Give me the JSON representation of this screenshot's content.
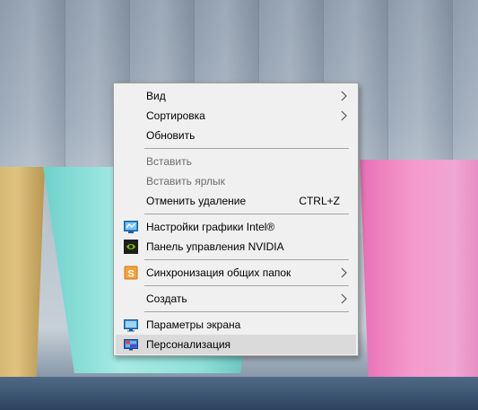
{
  "context_menu": {
    "items": [
      {
        "label": "Вид",
        "submenu": true
      },
      {
        "label": "Сортировка",
        "submenu": true
      },
      {
        "label": "Обновить"
      },
      {
        "label": "Вставить",
        "disabled": true
      },
      {
        "label": "Вставить ярлык",
        "disabled": true
      },
      {
        "label": "Отменить удаление",
        "shortcut": "CTRL+Z"
      },
      {
        "label": "Настройки графики Intel®",
        "icon": "intel-graphics-icon"
      },
      {
        "label": "Панель управления NVIDIA",
        "icon": "nvidia-icon"
      },
      {
        "label": "Синхронизация общих папок",
        "icon": "sync-folders-icon",
        "submenu": true
      },
      {
        "label": "Создать",
        "submenu": true
      },
      {
        "label": "Параметры экрана",
        "icon": "display-settings-icon"
      },
      {
        "label": "Персонализация",
        "icon": "personalization-icon",
        "highlighted": true
      }
    ]
  },
  "colors": {
    "menu_bg": "#f0f0f0",
    "highlight": "#dadada",
    "disabled_text": "#6d6d6d"
  }
}
